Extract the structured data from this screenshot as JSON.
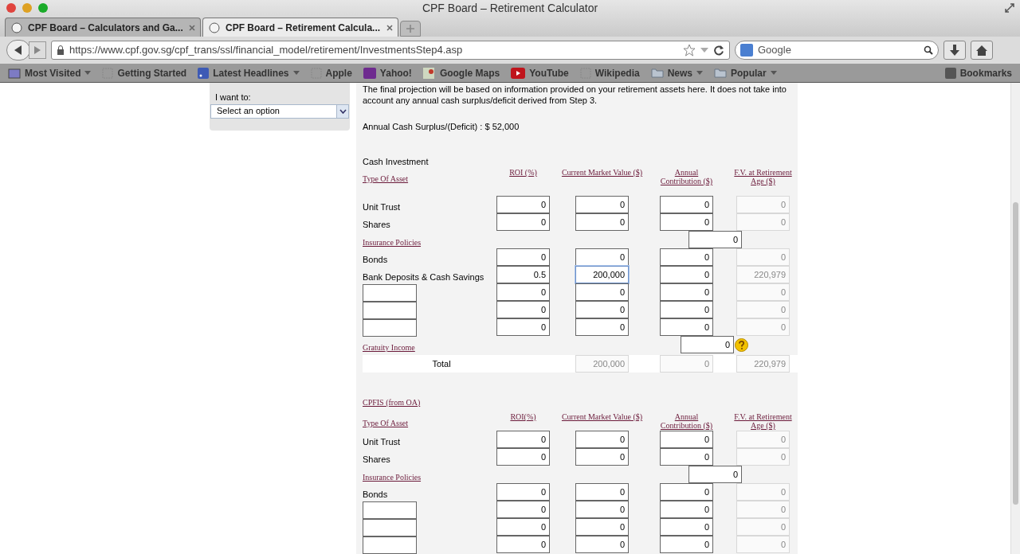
{
  "window": {
    "title": "CPF Board – Retirement Calculator"
  },
  "tabs": [
    {
      "title": "CPF Board – Calculators and Ga...",
      "selected": false
    },
    {
      "title": "CPF Board – Retirement Calcula...",
      "selected": true
    }
  ],
  "address": {
    "url": "https://www.cpf.gov.sg/cpf_trans/ssl/financial_model/retirement/InvestmentsStep4.asp"
  },
  "search": {
    "placeholder": "Google"
  },
  "bookmarks": [
    {
      "label": "Most Visited",
      "menu": true,
      "kind": "star"
    },
    {
      "label": "Getting Started",
      "menu": false,
      "kind": "page"
    },
    {
      "label": "Latest Headlines",
      "menu": true,
      "kind": "feed"
    },
    {
      "label": "Apple",
      "menu": false,
      "kind": "page"
    },
    {
      "label": "Yahoo!",
      "menu": false,
      "kind": "yahoo"
    },
    {
      "label": "Google Maps",
      "menu": false,
      "kind": "map"
    },
    {
      "label": "YouTube",
      "menu": false,
      "kind": "video"
    },
    {
      "label": "Wikipedia",
      "menu": false,
      "kind": "page"
    },
    {
      "label": "News",
      "menu": true,
      "kind": "folder"
    },
    {
      "label": "Popular",
      "menu": true,
      "kind": "folder"
    }
  ],
  "bookmarks_menu": "Bookmarks",
  "sidebar": {
    "label": "I want to:",
    "select": "Select an option"
  },
  "intro": "The final projection will be based on information provided on your retirement assets here. It does not take into account any annual cash surplus/deficit derived from Step 3.",
  "annual_surplus": "Annual Cash Surplus/(Deficit) : $ 52,000",
  "sections": [
    {
      "heading": "Cash Investment",
      "heading_link": false,
      "columns": [
        "Type Of Asset",
        "ROI (%)",
        "Current Market Value ($)",
        "Annual Contribution ($)",
        "F.V. at Retirement Age ($)"
      ],
      "rows": [
        {
          "kind": "asset",
          "label": "Unit Trust",
          "roi": "0",
          "value": "0",
          "contribution": "0",
          "fv": "0",
          "focused": false
        },
        {
          "kind": "asset",
          "label": "Shares",
          "roi": "0",
          "value": "0",
          "contribution": "0",
          "fv": "0",
          "focused": false
        },
        {
          "kind": "link",
          "label": "Insurance Policies",
          "fv": "0"
        },
        {
          "kind": "asset",
          "label": "Bonds",
          "roi": "0",
          "value": "0",
          "contribution": "0",
          "fv": "0",
          "focused": false
        },
        {
          "kind": "asset",
          "label": "Bank Deposits & Cash Savings",
          "roi": "0.5",
          "value": "200,000",
          "contribution": "0",
          "fv": "220,979",
          "focused": true
        },
        {
          "kind": "custom",
          "roi": "0",
          "value": "0",
          "contribution": "0",
          "fv": "0",
          "focused": false
        },
        {
          "kind": "custom",
          "roi": "0",
          "value": "0",
          "contribution": "0",
          "fv": "0",
          "focused": false
        },
        {
          "kind": "custom",
          "roi": "0",
          "value": "0",
          "contribution": "0",
          "fv": "0",
          "focused": false
        },
        {
          "kind": "help_link",
          "label": "Gratuity Income",
          "fv": "0"
        },
        {
          "kind": "total",
          "label": "Total",
          "value": "200,000",
          "contribution": "0",
          "fv": "220,979"
        }
      ]
    },
    {
      "heading": "CPFIS (from OA)",
      "heading_link": true,
      "columns": [
        "Type Of Asset",
        "ROI(%)",
        "Current Market Value ($)",
        "Annual Contribution ($)",
        "F.V. at Retirement Age ($)"
      ],
      "rows": [
        {
          "kind": "asset",
          "label": "Unit Trust",
          "roi": "0",
          "value": "0",
          "contribution": "0",
          "fv": "0",
          "focused": false
        },
        {
          "kind": "asset",
          "label": "Shares",
          "roi": "0",
          "value": "0",
          "contribution": "0",
          "fv": "0",
          "focused": false
        },
        {
          "kind": "link",
          "label": "Insurance Policies",
          "fv": "0"
        },
        {
          "kind": "asset",
          "label": "Bonds",
          "roi": "0",
          "value": "0",
          "contribution": "0",
          "fv": "0",
          "focused": false
        },
        {
          "kind": "custom",
          "roi": "0",
          "value": "0",
          "contribution": "0",
          "fv": "0",
          "focused": false
        },
        {
          "kind": "custom",
          "roi": "0",
          "value": "0",
          "contribution": "0",
          "fv": "0",
          "focused": false
        },
        {
          "kind": "custom",
          "roi": "0",
          "value": "0",
          "contribution": "0",
          "fv": "0",
          "focused": false
        }
      ]
    }
  ]
}
